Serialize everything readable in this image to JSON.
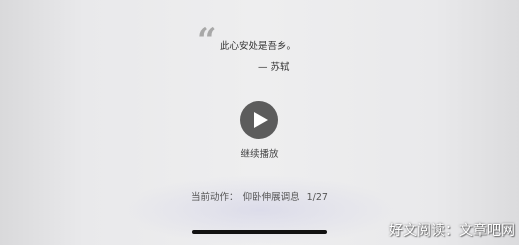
{
  "quote": {
    "mark": "“",
    "text": "此心安处是吾乡。",
    "author": "—  苏轼"
  },
  "player": {
    "play_icon": "play-icon",
    "continue_label": "继续播放"
  },
  "status": {
    "action_label": "当前动作：",
    "action_name": "仰卧伸展调息",
    "progress": "1/27"
  },
  "watermark": "好文阅读：文章吧网",
  "colors": {
    "play_button_bg": "#5c5c5c",
    "quote_mark": "#a8a8a8"
  }
}
